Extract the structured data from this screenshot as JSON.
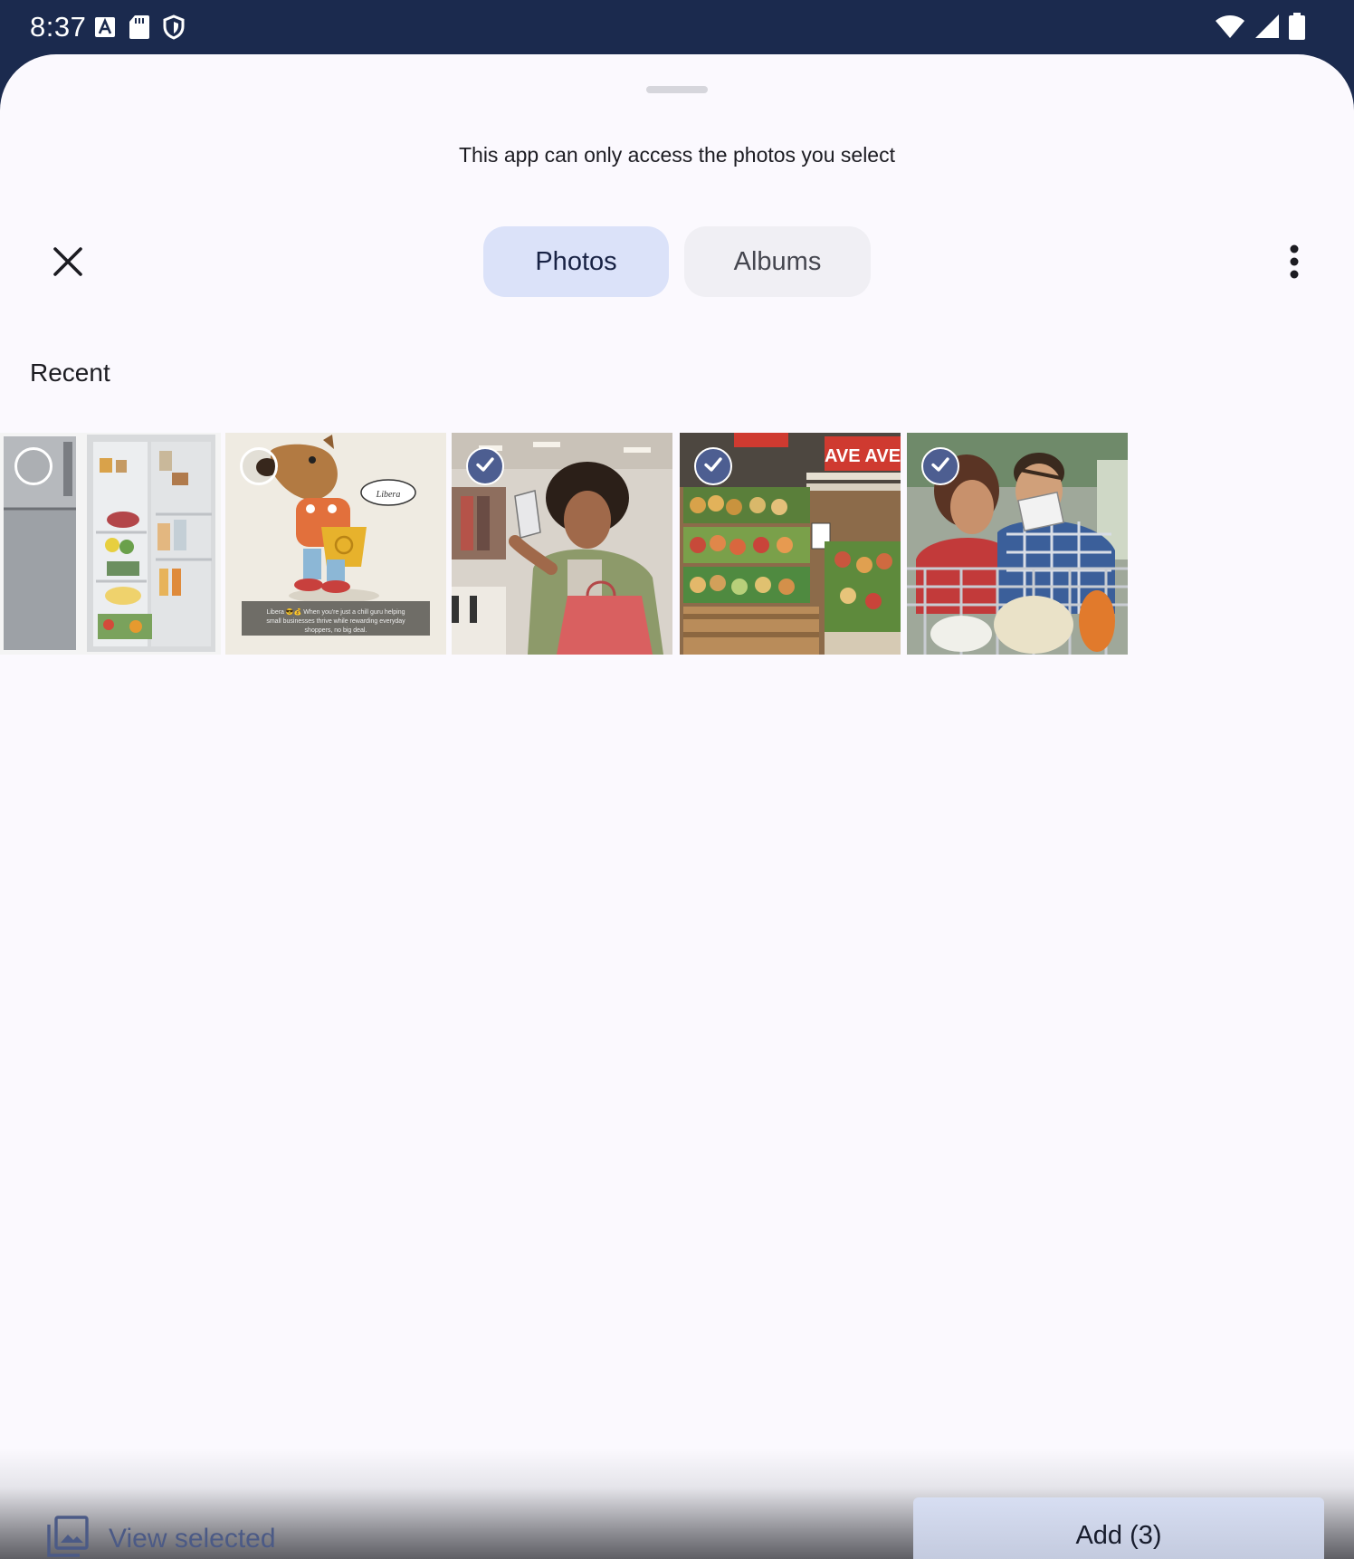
{
  "status_bar": {
    "time": "8:37",
    "left_icons": [
      "text-a-icon",
      "sd-card-icon",
      "shield-icon"
    ],
    "right_icons": [
      "wifi-icon",
      "cell-signal-icon",
      "battery-icon"
    ]
  },
  "sheet": {
    "notice": "This app can only access the photos you select",
    "tabs": [
      {
        "label": "Photos",
        "selected": true
      },
      {
        "label": "Albums",
        "selected": false
      }
    ],
    "section_title": "Recent",
    "photos": [
      {
        "subject": "refrigerator",
        "selected": false
      },
      {
        "subject": "cartoon-dog-with-shopping-bag",
        "selected": false,
        "caption": "Libera 😎💰 When you're just a chill guru helping small businesses thrive while rewarding everyday shoppers, no big deal."
      },
      {
        "subject": "woman-selfie-shopping",
        "selected": true
      },
      {
        "subject": "supermarket-produce",
        "selected": true
      },
      {
        "subject": "couple-selfie-with-cart",
        "selected": true
      }
    ],
    "bubble_text": "Libera",
    "store_sign": "AVE AVE"
  },
  "bottom_bar": {
    "view_selected_label": "View selected",
    "add_label": "Add (3)"
  },
  "colors": {
    "status_bar": "#1b2a4e",
    "sheet_bg": "#fbf9fe",
    "tab_selected": "#dbe2f9",
    "tab_unselected": "#f0eff4",
    "check_fill": "#4d5e91",
    "view_selected_text": "#4b5a86",
    "add_button": "#d7def2"
  }
}
